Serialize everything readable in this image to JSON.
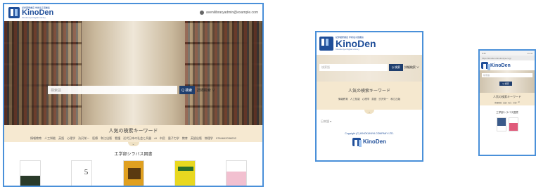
{
  "brand": {
    "tagline": "紀伊國屋書店 学術電子図書館",
    "name": "KinoDen",
    "subtitle": "Kinokuniya Digital Library"
  },
  "desktop": {
    "user_email": "avenilibraryadmin@example.com",
    "search": {
      "placeholder": "検索語",
      "button_label": "Q 検索",
      "advanced_label": "詳細検索 ∨"
    },
    "keywords": {
      "title": "人気の検索キーワード",
      "items": [
        "情報教育",
        "人工知能",
        "英語",
        "心理学",
        "渋沢栄一",
        "医療",
        "和江出版",
        "看護",
        "近代日本の社会と兵器",
        "AI",
        "市民",
        "量子力学",
        "教育",
        "英語出版",
        "物理学",
        "9784642036032"
      ]
    },
    "chevron": "⌄",
    "section_title": "工学部シラバス図書"
  },
  "tablet": {
    "search": {
      "placeholder": "検索語",
      "button_label": "Q 検索",
      "advanced_label": "詳細検索 ∨"
    },
    "keywords": {
      "title": "人気の検索キーワード",
      "items": [
        "情報教育",
        "人工知能",
        "心理学",
        "英語",
        "渋沢栄一",
        "和江出版"
      ]
    },
    "chevron": "⌄",
    "language": "日本語 ▾",
    "copyright": "Copyright (C) KINOKUNIYA COMPANY LTD."
  },
  "phone": {
    "status_left": "9:41",
    "status_right": "● ● ●",
    "url": "https://kinoden.kinokuniya.co.jp",
    "search_placeholder": "検索語",
    "button_label": "Q 検索",
    "keywords": {
      "title": "人気の検索キーワード",
      "items": [
        "情報教育",
        "英語",
        "和江",
        "渋沢",
        "AI"
      ]
    },
    "section_title": "工学部シラバス図書"
  }
}
